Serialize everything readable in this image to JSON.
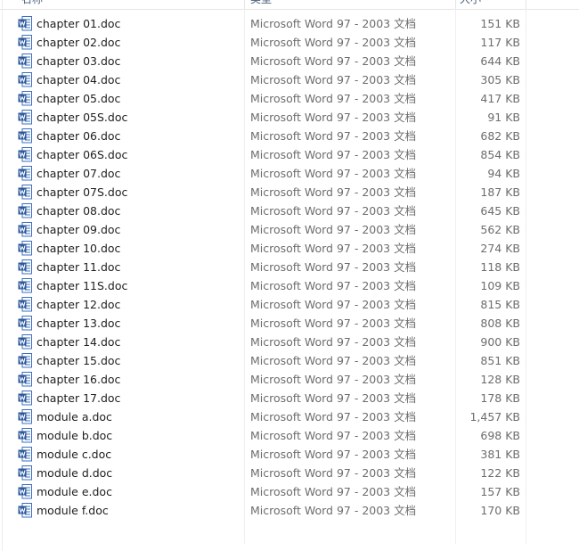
{
  "header": {
    "name_label": "名称",
    "type_label": "类型",
    "size_label": "大小"
  },
  "files": [
    {
      "name": "chapter 01.doc",
      "type": "Microsoft Word 97 - 2003 文档",
      "size": "151 KB",
      "icon": "word-doc-icon"
    },
    {
      "name": "chapter 02.doc",
      "type": "Microsoft Word 97 - 2003 文档",
      "size": "117 KB",
      "icon": "word-doc-icon"
    },
    {
      "name": "chapter 03.doc",
      "type": "Microsoft Word 97 - 2003 文档",
      "size": "644 KB",
      "icon": "word-doc-icon"
    },
    {
      "name": "chapter 04.doc",
      "type": "Microsoft Word 97 - 2003 文档",
      "size": "305 KB",
      "icon": "word-doc-icon"
    },
    {
      "name": "chapter 05.doc",
      "type": "Microsoft Word 97 - 2003 文档",
      "size": "417 KB",
      "icon": "word-doc-icon"
    },
    {
      "name": "chapter 05S.doc",
      "type": "Microsoft Word 97 - 2003 文档",
      "size": "91 KB",
      "icon": "word-doc-icon"
    },
    {
      "name": "chapter 06.doc",
      "type": "Microsoft Word 97 - 2003 文档",
      "size": "682 KB",
      "icon": "word-doc-icon"
    },
    {
      "name": "chapter 06S.doc",
      "type": "Microsoft Word 97 - 2003 文档",
      "size": "854 KB",
      "icon": "word-doc-icon"
    },
    {
      "name": "chapter 07.doc",
      "type": "Microsoft Word 97 - 2003 文档",
      "size": "94 KB",
      "icon": "word-doc-icon"
    },
    {
      "name": "chapter 07S.doc",
      "type": "Microsoft Word 97 - 2003 文档",
      "size": "187 KB",
      "icon": "word-doc-icon"
    },
    {
      "name": "chapter 08.doc",
      "type": "Microsoft Word 97 - 2003 文档",
      "size": "645 KB",
      "icon": "word-doc-icon"
    },
    {
      "name": "chapter 09.doc",
      "type": "Microsoft Word 97 - 2003 文档",
      "size": "562 KB",
      "icon": "word-doc-icon"
    },
    {
      "name": "chapter 10.doc",
      "type": "Microsoft Word 97 - 2003 文档",
      "size": "274 KB",
      "icon": "word-doc-icon"
    },
    {
      "name": "chapter 11.doc",
      "type": "Microsoft Word 97 - 2003 文档",
      "size": "118 KB",
      "icon": "word-doc-icon"
    },
    {
      "name": "chapter 11S.doc",
      "type": "Microsoft Word 97 - 2003 文档",
      "size": "109 KB",
      "icon": "word-doc-icon"
    },
    {
      "name": "chapter 12.doc",
      "type": "Microsoft Word 97 - 2003 文档",
      "size": "815 KB",
      "icon": "word-doc-icon"
    },
    {
      "name": "chapter 13.doc",
      "type": "Microsoft Word 97 - 2003 文档",
      "size": "808 KB",
      "icon": "word-doc-icon"
    },
    {
      "name": "chapter 14.doc",
      "type": "Microsoft Word 97 - 2003 文档",
      "size": "900 KB",
      "icon": "word-doc-icon"
    },
    {
      "name": "chapter 15.doc",
      "type": "Microsoft Word 97 - 2003 文档",
      "size": "851 KB",
      "icon": "word-doc-icon"
    },
    {
      "name": "chapter 16.doc",
      "type": "Microsoft Word 97 - 2003 文档",
      "size": "128 KB",
      "icon": "word-doc-icon"
    },
    {
      "name": "chapter 17.doc",
      "type": "Microsoft Word 97 - 2003 文档",
      "size": "178 KB",
      "icon": "word-doc-icon"
    },
    {
      "name": "module a.doc",
      "type": "Microsoft Word 97 - 2003 文档",
      "size": "1,457 KB",
      "icon": "word-doc-icon"
    },
    {
      "name": "module b.doc",
      "type": "Microsoft Word 97 - 2003 文档",
      "size": "698 KB",
      "icon": "word-doc-icon"
    },
    {
      "name": "module c.doc",
      "type": "Microsoft Word 97 - 2003 文档",
      "size": "381 KB",
      "icon": "word-doc-icon"
    },
    {
      "name": "module d.doc",
      "type": "Microsoft Word 97 - 2003 文档",
      "size": "122 KB",
      "icon": "word-doc-icon"
    },
    {
      "name": "module e.doc",
      "type": "Microsoft Word 97 - 2003 文档",
      "size": "157 KB",
      "icon": "word-doc-icon"
    },
    {
      "name": "module f.doc",
      "type": "Microsoft Word 97 - 2003 文档",
      "size": "170 KB",
      "icon": "word-doc-icon"
    }
  ],
  "colors": {
    "word_blue": "#2b579a",
    "word_blue_light": "#3c6fbf",
    "secondary_text": "#6d6d6d"
  }
}
